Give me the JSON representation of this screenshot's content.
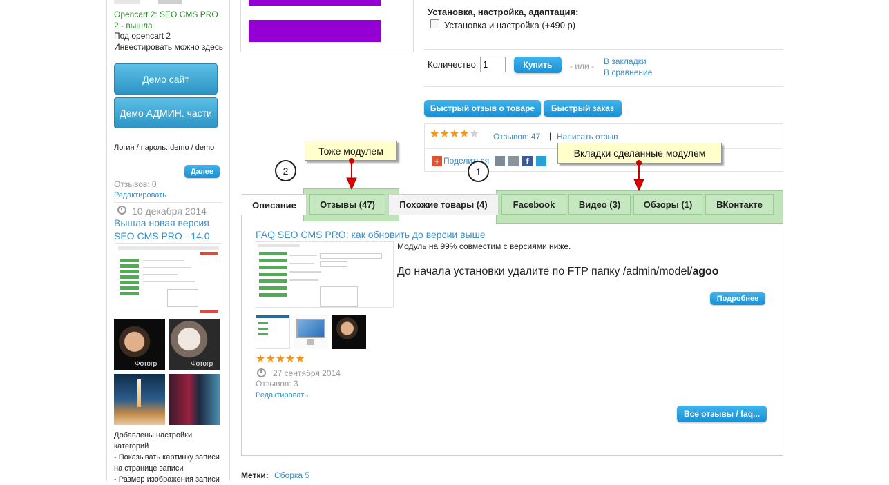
{
  "sidebar": {
    "news_title": "Opencart 2: SEO CMS PRO 2 - вышла",
    "line_under": "Под opencart 2",
    "line_invest": "Инвестировать можно здесь",
    "demo_site_label": "Демо сайт",
    "demo_admin_label": "Демо АДМИН. части",
    "login_text": "Логин / пароль: demo / demo",
    "next_label": "Далее",
    "reviews_count": "Отзывов: 0",
    "edit_label": "Редактировать",
    "post_date": "10 декабря 2014",
    "post_title": "Вышла новая версия SEO CMS PRO - 14.0",
    "photo_caption": "Фотогр",
    "post2_lines": [
      "Добавлены настройки",
      "категорий",
      "- Показывать картинку записи",
      "на странице записи",
      "- Размер изображения записи"
    ]
  },
  "product": {
    "options_title": "Установка, настройка, адаптация:",
    "option_label": "Установка и настройка (+490 р)",
    "qty_label": "Количество:",
    "qty_value": "1",
    "buy_label": "Купить",
    "or_label": "- или -",
    "wishlist_label": "В закладки",
    "compare_label": "В сравнение",
    "quick_review_label": "Быстрый отзыв о товаре",
    "quick_order_label": "Быстрый заказ",
    "rating_value": 4,
    "rating_max": 5,
    "reviews_link": "Отзывов: 47",
    "separator": "|",
    "write_review_link": "Написать отзыв",
    "share_label": "Поделиться",
    "accent_color": "#9400d3"
  },
  "annotations": {
    "callout_reviews": "Тоже модулем",
    "callout_tabs": "Вкладки сделанные модулем",
    "num_1": "1",
    "num_2": "2"
  },
  "tabs": [
    {
      "label": "Описание"
    },
    {
      "label": "Отзывы (47)"
    },
    {
      "label": "Похожие товары (4)"
    },
    {
      "label": "Facebook"
    },
    {
      "label": "Видео (3)"
    },
    {
      "label": "Обзоры (1)"
    },
    {
      "label": "ВКонтакте"
    }
  ],
  "review": {
    "title": "FAQ SEO CMS PRO: как обновить до версии выше",
    "line1": "Модуль на 99% совместим с версиями ниже.",
    "line2_prefix": "До начала установки удалите по FTP папку /admin/model/",
    "line2_bold": "agoo",
    "more_label": "Подробнее",
    "rating_value": 5,
    "date": "27 сентября 2014",
    "reviews_count": "Отзывов: 3",
    "edit_label": "Редактировать",
    "all_label": "Все отзывы / faq..."
  },
  "tags": {
    "label": "Метки:",
    "link": "Сборка 5"
  }
}
